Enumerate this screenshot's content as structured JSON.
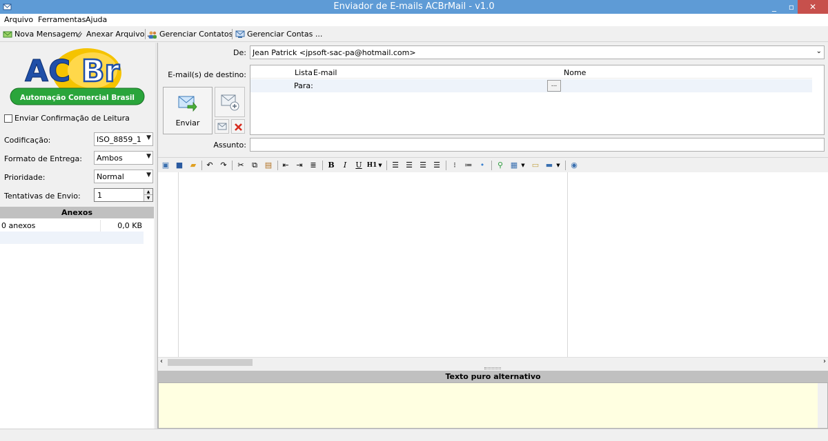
{
  "window": {
    "title": "Enviador de E-mails ACBrMail - v1.0",
    "minimize": "_",
    "maximize": "▫",
    "close": "✕"
  },
  "menu": [
    "Arquivo",
    "Ferramentas",
    "Ajuda"
  ],
  "toolbar": {
    "new_message": "Nova Mensagem",
    "attach": "Anexar Arquivo ...",
    "contacts": "Gerenciar Contatos ...",
    "accounts": "Gerenciar Contas ..."
  },
  "logo": {
    "text_ac": "AC",
    "text_br": "Br",
    "subtitle": "Automação Comercial Brasil"
  },
  "options": {
    "read_receipt_label": "Enviar Confirmação de Leitura",
    "read_receipt_checked": false,
    "encoding_label": "Codificação:",
    "encoding_value": "ISO_8859_1",
    "format_label": "Formato de Entrega:",
    "format_value": "Ambos",
    "priority_label": "Prioridade:",
    "priority_value": "Normal",
    "attempts_label": "Tentativas de Envio:",
    "attempts_value": "1"
  },
  "attachments": {
    "header": "Anexos",
    "rows": [
      {
        "name": "0 anexos",
        "size": "0,0 KB"
      }
    ]
  },
  "compose": {
    "from_label": "De:",
    "from_value": "Jean Patrick <jpsoft-sac-pa@hotmail.com>",
    "dest_label": "E-mail(s) de destino:",
    "grid_headers": {
      "list": "Lista",
      "email": "E-mail",
      "name": "Nome"
    },
    "grid_row": {
      "type": "Para:",
      "email": "",
      "name": "",
      "browse": "..."
    },
    "send_label": "Enviar",
    "subject_label": "Assunto:",
    "subject_value": ""
  },
  "editor": {
    "bold": "B",
    "italic": "I",
    "underline": "U",
    "heading": "H1"
  },
  "plain_text": {
    "header": "Texto puro alternativo",
    "value": ""
  },
  "colors": {
    "titlebar": "#5e9bd6",
    "close": "#c7504c",
    "plain_bg": "#ffffe1",
    "logo_blue": "#1f4fa8",
    "logo_yellow": "#f5c300",
    "logo_green": "#2aa53b"
  }
}
